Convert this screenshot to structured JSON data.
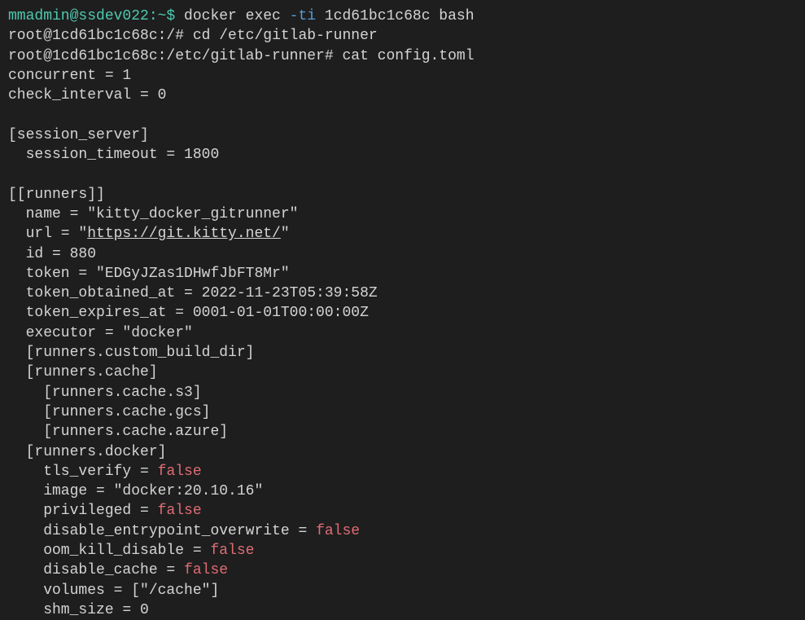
{
  "line1": {
    "prompt": "mmadmin@ssdev022:~$",
    "cmd1": " docker exec ",
    "flag": "-ti",
    "cmd2": " 1cd61bc1c68c bash"
  },
  "line2": {
    "prompt": "root@1cd61bc1c68c:/#",
    "cmd": " cd /etc/gitlab-runner"
  },
  "line3": {
    "prompt": "root@1cd61bc1c68c:/etc/gitlab-runner#",
    "cmd": " cat config.toml"
  },
  "line4": "concurrent = 1",
  "line5": "check_interval = 0",
  "line6": "",
  "line7": "[session_server]",
  "line8": "  session_timeout = 1800",
  "line9": "",
  "line10": "[[runners]]",
  "line11": "  name = \"kitty_docker_gitrunner\"",
  "line12a": "  url = \"",
  "line12b": "https://git.kitty.net/",
  "line12c": "\"",
  "line13": "  id = 880",
  "line14": "  token = \"EDGyJZas1DHwfJbFT8Mr\"",
  "line15": "  token_obtained_at = 2022-11-23T05:39:58Z",
  "line16": "  token_expires_at = 0001-01-01T00:00:00Z",
  "line17": "  executor = \"docker\"",
  "line18": "  [runners.custom_build_dir]",
  "line19": "  [runners.cache]",
  "line20": "    [runners.cache.s3]",
  "line21": "    [runners.cache.gcs]",
  "line22": "    [runners.cache.azure]",
  "line23": "  [runners.docker]",
  "line24a": "    tls_verify = ",
  "line24b": "false",
  "line25": "    image = \"docker:20.10.16\"",
  "line26a": "    privileged = ",
  "line26b": "false",
  "line27a": "    disable_entrypoint_overwrite = ",
  "line27b": "false",
  "line28a": "    oom_kill_disable = ",
  "line28b": "false",
  "line29a": "    disable_cache = ",
  "line29b": "false",
  "line30": "    volumes = [\"/cache\"]",
  "line31": "    shm_size = 0"
}
